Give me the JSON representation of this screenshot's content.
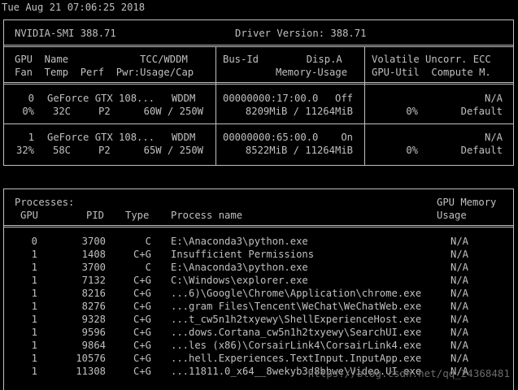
{
  "timestamp": "Tue Aug 21 07:06:25 2018",
  "header": {
    "smi": "NVIDIA-SMI 388.71",
    "driver": "Driver Version: 388.71"
  },
  "columns": {
    "left1": "GPU  Name            TCC/WDDM",
    "left2": "Fan  Temp  Perf  Pwr:Usage/Cap",
    "mid1": "Bus-Id        Disp.A",
    "mid2": "Memory-Usage",
    "right1": "Volatile Uncorr. ECC",
    "right2": "GPU-Util  Compute M."
  },
  "gpus": [
    {
      "index": "0",
      "name": "GeForce GTX 108...",
      "mode": "WDDM",
      "fan": "0%",
      "temp": "32C",
      "perf": "P2",
      "power": "60W / 250W",
      "bus_id": "00000000:17:00.0",
      "disp": "Off",
      "memory": "8209MiB / 11264MiB",
      "ecc": "N/A",
      "util": "0%",
      "compute": "Default"
    },
    {
      "index": "1",
      "name": "GeForce GTX 108...",
      "mode": "WDDM",
      "fan": "32%",
      "temp": "58C",
      "perf": "P2",
      "power": "65W / 250W",
      "bus_id": "00000000:65:00.0",
      "disp": "On",
      "memory": "8522MiB / 11264MiB",
      "ecc": "N/A",
      "util": "0%",
      "compute": "Default"
    }
  ],
  "processes": {
    "title": "Processes:",
    "mem_header1": "GPU Memory",
    "mem_header2": "Usage",
    "col_gpu": "GPU",
    "col_pid": "PID",
    "col_type": "Type",
    "col_name": "Process name",
    "rows": [
      {
        "gpu": "0",
        "pid": "3700",
        "type": "C",
        "name": "E:\\Anaconda3\\python.exe",
        "mem": "N/A"
      },
      {
        "gpu": "1",
        "pid": "1408",
        "type": "C+G",
        "name": "Insufficient Permissions",
        "mem": "N/A"
      },
      {
        "gpu": "1",
        "pid": "3700",
        "type": "C",
        "name": "E:\\Anaconda3\\python.exe",
        "mem": "N/A"
      },
      {
        "gpu": "1",
        "pid": "7132",
        "type": "C+G",
        "name": "C:\\Windows\\explorer.exe",
        "mem": "N/A"
      },
      {
        "gpu": "1",
        "pid": "8216",
        "type": "C+G",
        "name": "...6)\\Google\\Chrome\\Application\\chrome.exe",
        "mem": "N/A"
      },
      {
        "gpu": "1",
        "pid": "8276",
        "type": "C+G",
        "name": "...gram Files\\Tencent\\WeChat\\WeChatWeb.exe",
        "mem": "N/A"
      },
      {
        "gpu": "1",
        "pid": "9328",
        "type": "C+G",
        "name": "...t_cw5n1h2txyewy\\ShellExperienceHost.exe",
        "mem": "N/A"
      },
      {
        "gpu": "1",
        "pid": "9596",
        "type": "C+G",
        "name": "...dows.Cortana_cw5n1h2txyewy\\SearchUI.exe",
        "mem": "N/A"
      },
      {
        "gpu": "1",
        "pid": "9864",
        "type": "C+G",
        "name": "...les (x86)\\CorsairLink4\\CorsairLink4.exe",
        "mem": "N/A"
      },
      {
        "gpu": "1",
        "pid": "10576",
        "type": "C+G",
        "name": "...hell.Experiences.TextInput.InputApp.exe",
        "mem": "N/A"
      },
      {
        "gpu": "1",
        "pid": "11308",
        "type": "C+G",
        "name": "...11811.0_x64__8wekyb3d8bbwe\\Video.UI.exe",
        "mem": "N/A"
      }
    ]
  },
  "watermark": "https://blog.csdn.net/qq_24368481"
}
